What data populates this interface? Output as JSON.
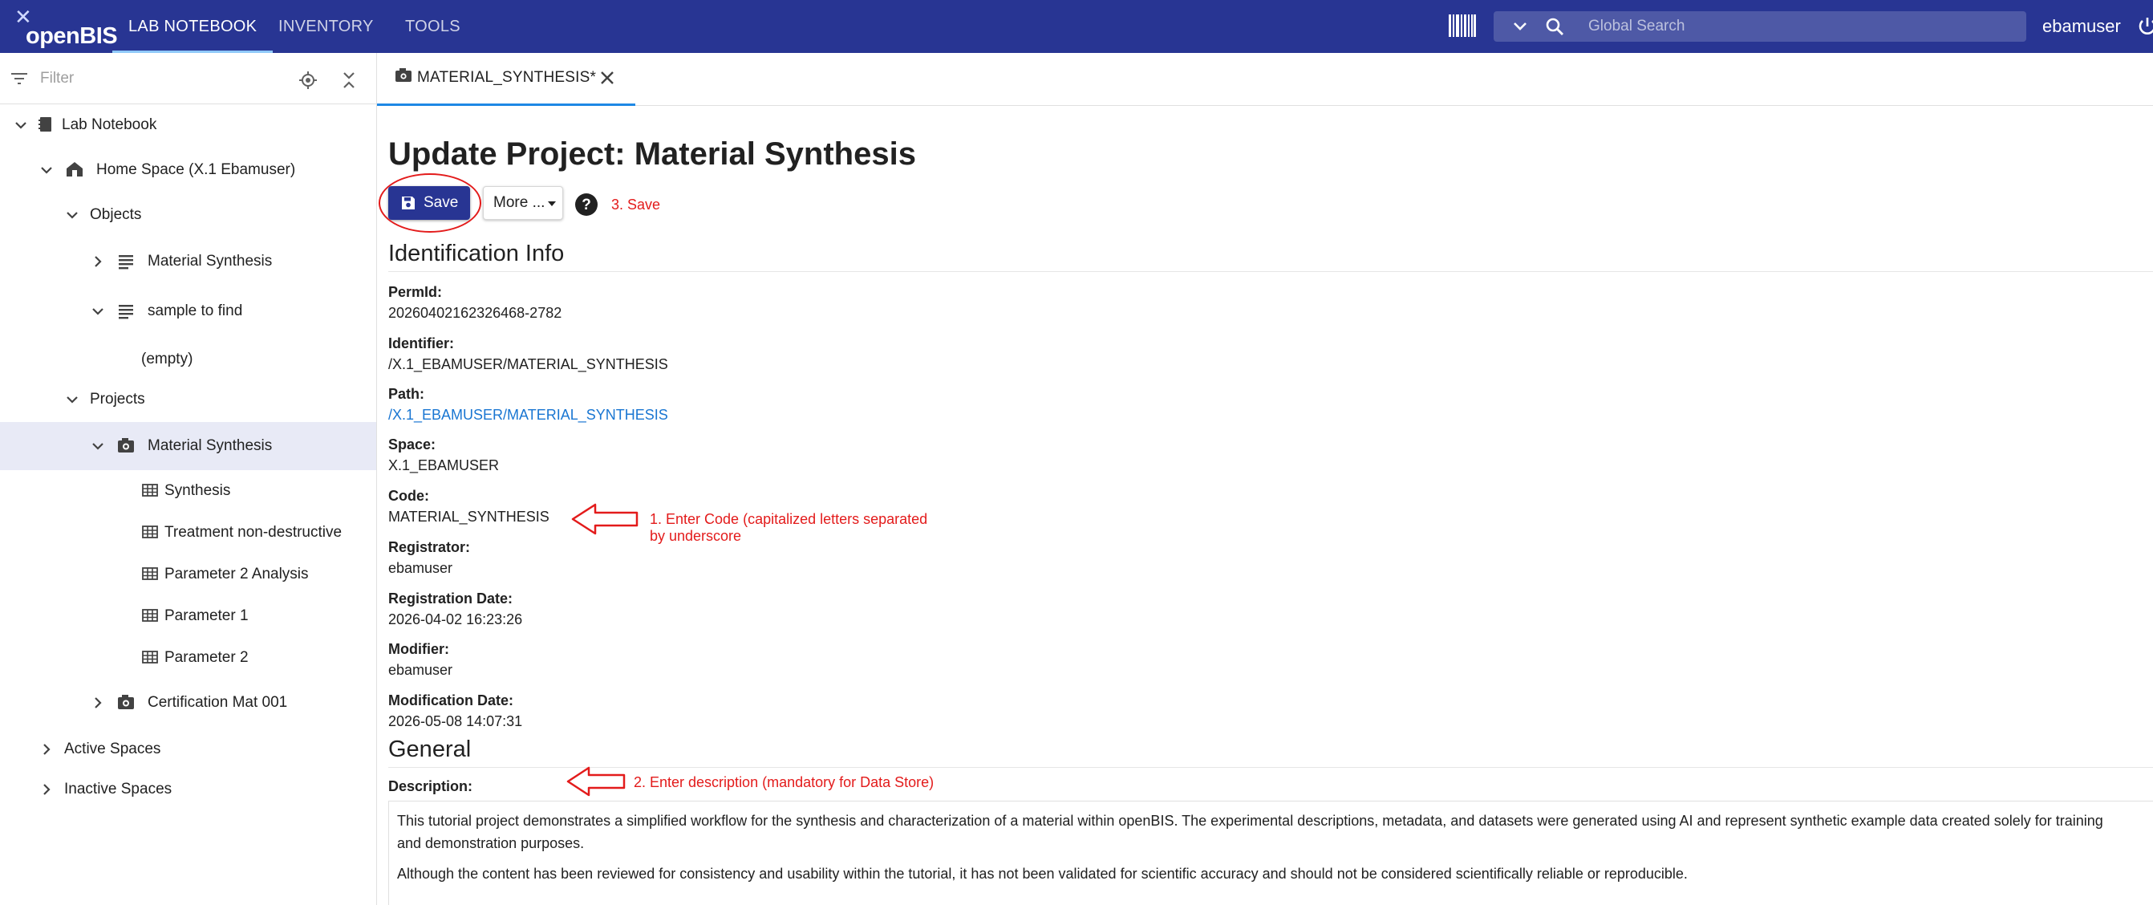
{
  "app": {
    "logo_text": "openBIS",
    "nav": [
      "LAB NOTEBOOK",
      "INVENTORY",
      "TOOLS"
    ],
    "search_placeholder": "Global Search",
    "username": "ebamuser"
  },
  "sidebar": {
    "filter_placeholder": "Filter",
    "tree": [
      {
        "label": "Lab Notebook",
        "icon": "notebook-icon",
        "state": "expanded"
      },
      {
        "label": "Home Space (X.1 Ebamuser)",
        "icon": "home-space-icon",
        "state": "expanded"
      },
      {
        "label": "Objects",
        "icon": "",
        "state": "expanded"
      },
      {
        "label": "Material Synthesis",
        "icon": "object-lines-icon",
        "state": "collapsed"
      },
      {
        "label": "sample to find",
        "icon": "object-lines-icon",
        "state": "expanded"
      },
      {
        "label": "(empty)",
        "icon": "",
        "state": "none"
      },
      {
        "label": "Projects",
        "icon": "",
        "state": "expanded"
      },
      {
        "label": "Material Synthesis",
        "icon": "project-camera-icon",
        "state": "expanded",
        "selected": true
      },
      {
        "label": "Synthesis",
        "icon": "table-icon",
        "state": "none"
      },
      {
        "label": "Treatment non-destructive",
        "icon": "table-icon",
        "state": "none"
      },
      {
        "label": "Parameter 2 Analysis",
        "icon": "table-icon",
        "state": "none"
      },
      {
        "label": "Parameter 1",
        "icon": "table-icon",
        "state": "none"
      },
      {
        "label": "Parameter 2",
        "icon": "table-icon",
        "state": "none"
      },
      {
        "label": "Certification Mat 001",
        "icon": "project-camera-icon",
        "state": "collapsed"
      },
      {
        "label": "Active Spaces",
        "icon": "",
        "state": "collapsed"
      },
      {
        "label": "Inactive Spaces",
        "icon": "",
        "state": "collapsed"
      }
    ]
  },
  "tab": {
    "label": "MATERIAL_SYNTHESIS*"
  },
  "page": {
    "title": "Update Project: Material Synthesis",
    "save_label": "Save",
    "more_label": "More ...",
    "help_icon": "help-circle-icon"
  },
  "annotations": {
    "save": "3. Save",
    "code_line1": "1. Enter Code (capitalized letters separated",
    "code_line2": "by underscore",
    "description": "2. Enter description (mandatory for Data Store)",
    "color": "#e31b1b"
  },
  "identification": {
    "title": "Identification Info",
    "permid_label": "PermId:",
    "permid": "20260402162326468-2782",
    "identifier_label": "Identifier:",
    "identifier": "/X.1_EBAMUSER/MATERIAL_SYNTHESIS",
    "path_label": "Path:",
    "path": "/X.1_EBAMUSER/MATERIAL_SYNTHESIS",
    "space_label": "Space:",
    "space": "X.1_EBAMUSER",
    "code_label": "Code:",
    "code": "MATERIAL_SYNTHESIS",
    "registrator_label": "Registrator:",
    "registrator": "ebamuser",
    "registration_date_label": "Registration Date:",
    "registration_date": "2026-04-02 16:23:26",
    "modifier_label": "Modifier:",
    "modifier": "ebamuser",
    "modification_date_label": "Modification Date:",
    "modification_date": "2026-05-08 14:07:31"
  },
  "general": {
    "title": "General",
    "description_label": "Description:",
    "description_p1": "This tutorial project demonstrates a simplified workflow for the synthesis and characterization of a material within openBIS. The experimental descriptions, metadata, and datasets were generated using AI and represent synthetic example data created solely for training and demonstration purposes.",
    "description_p2": "Although the content has been reviewed for consistency and usability within the tutorial, it has not been validated for scientific accuracy and should not be considered scientifically reliable or reproducible."
  },
  "colors": {
    "appbar": "#283593",
    "accent": "#1e88e5",
    "link": "#1976d2",
    "selected_row": "#e8eaf6"
  }
}
